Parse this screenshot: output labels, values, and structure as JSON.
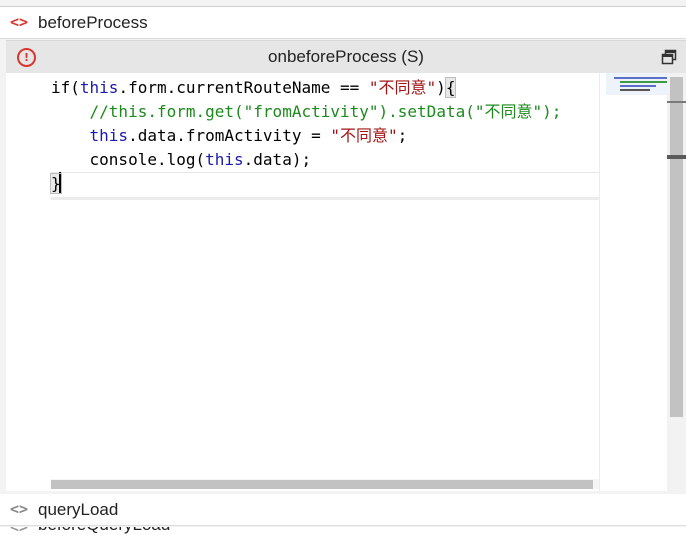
{
  "sections": {
    "before_process": {
      "label": "beforeProcess",
      "icon": "code-brackets-icon",
      "icon_color": "#d8362f"
    },
    "query_load": {
      "label": "queryLoad",
      "icon": "code-brackets-icon",
      "icon_color": "#888888"
    },
    "next_partial": {
      "label": "beforeQueryLoad",
      "icon": "code-brackets-icon"
    }
  },
  "panel": {
    "title": "onbeforeProcess (S)",
    "status_icon": "error-circle-icon",
    "maximize_icon": "restore-window-icon"
  },
  "editor": {
    "lines": [
      {
        "indent": "",
        "tokens": [
          {
            "t": "if(",
            "c": ""
          },
          {
            "t": "this",
            "c": "kw"
          },
          {
            "t": ".form.currentRouteName == ",
            "c": ""
          },
          {
            "t": "\"不同意\"",
            "c": "str"
          },
          {
            "t": ")",
            "c": ""
          },
          {
            "t": "{",
            "c": "brace"
          }
        ]
      },
      {
        "indent": "    ",
        "tokens": [
          {
            "t": "//this.form.get(\"fromActivity\").setData(\"不同意\");",
            "c": "cm"
          }
        ]
      },
      {
        "indent": "    ",
        "tokens": [
          {
            "t": "this",
            "c": "kw"
          },
          {
            "t": ".data.fromActivity = ",
            "c": ""
          },
          {
            "t": "\"不同意\"",
            "c": "str"
          },
          {
            "t": ";",
            "c": ""
          }
        ]
      },
      {
        "indent": "    ",
        "tokens": [
          {
            "t": "console.log(",
            "c": ""
          },
          {
            "t": "this",
            "c": "kw"
          },
          {
            "t": ".data);",
            "c": ""
          }
        ]
      },
      {
        "indent": "",
        "tokens": [
          {
            "t": "}",
            "c": "brace"
          }
        ],
        "caret": true
      }
    ],
    "colors": {
      "keyword": "#1a1ab0",
      "string": "#a31515",
      "comment": "#1d8a1d"
    }
  }
}
